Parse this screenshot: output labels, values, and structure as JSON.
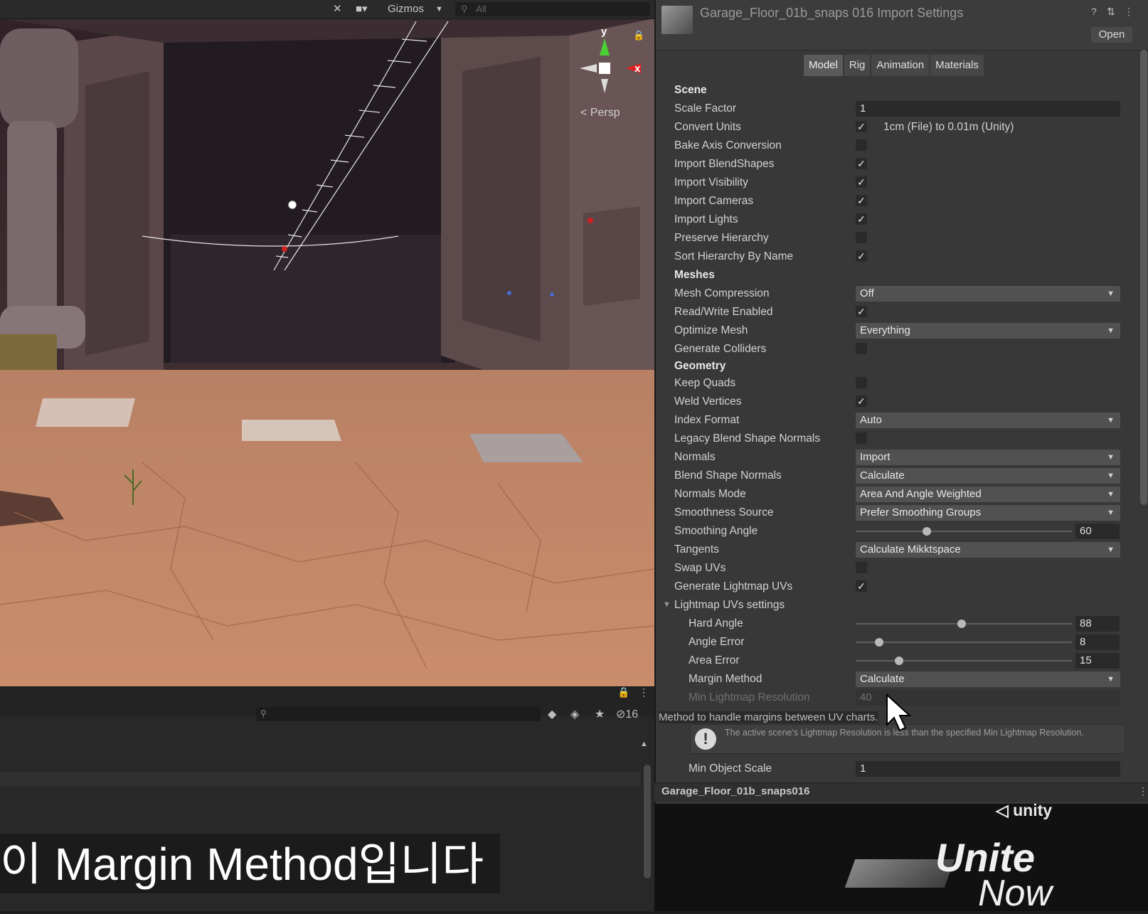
{
  "scene": {
    "gizmos_label": "Gizmos",
    "search_placeholder": "All",
    "persp_label": "Persp",
    "axis_y": "y",
    "axis_x": "x"
  },
  "hierarchy": {
    "hidden_count": "16"
  },
  "subtitle": "이 Margin Method입니다",
  "inspector": {
    "title": "Garage_Floor_01b_snaps 016 Import Settings",
    "open_label": "Open",
    "tabs": [
      "Model",
      "Rig",
      "Animation",
      "Materials"
    ],
    "sections": {
      "scene": "Scene",
      "meshes": "Meshes",
      "geometry": "Geometry"
    },
    "scale_factor": {
      "label": "Scale Factor",
      "value": "1"
    },
    "convert_units": {
      "label": "Convert Units",
      "checked": true,
      "text": "1cm (File) to 0.01m (Unity)"
    },
    "bake_axis": {
      "label": "Bake Axis Conversion",
      "checked": false
    },
    "import_blendshapes": {
      "label": "Import BlendShapes",
      "checked": true
    },
    "import_visibility": {
      "label": "Import Visibility",
      "checked": true
    },
    "import_cameras": {
      "label": "Import Cameras",
      "checked": true
    },
    "import_lights": {
      "label": "Import Lights",
      "checked": true
    },
    "preserve_hierarchy": {
      "label": "Preserve Hierarchy",
      "checked": false
    },
    "sort_hierarchy": {
      "label": "Sort Hierarchy By Name",
      "checked": true
    },
    "mesh_compression": {
      "label": "Mesh Compression",
      "value": "Off"
    },
    "read_write": {
      "label": "Read/Write Enabled",
      "checked": true
    },
    "optimize_mesh": {
      "label": "Optimize Mesh",
      "value": "Everything"
    },
    "generate_colliders": {
      "label": "Generate Colliders",
      "checked": false
    },
    "keep_quads": {
      "label": "Keep Quads",
      "checked": false
    },
    "weld_vertices": {
      "label": "Weld Vertices",
      "checked": true
    },
    "index_format": {
      "label": "Index Format",
      "value": "Auto"
    },
    "legacy_blend": {
      "label": "Legacy Blend Shape Normals",
      "checked": false
    },
    "normals": {
      "label": "Normals",
      "value": "Import"
    },
    "blend_shape_normals": {
      "label": "Blend Shape Normals",
      "value": "Calculate"
    },
    "normals_mode": {
      "label": "Normals Mode",
      "value": "Area And Angle Weighted"
    },
    "smoothness_source": {
      "label": "Smoothness Source",
      "value": "Prefer Smoothing Groups"
    },
    "smoothing_angle": {
      "label": "Smoothing Angle",
      "value": "60",
      "fraction": 0.33
    },
    "tangents": {
      "label": "Tangents",
      "value": "Calculate Mikktspace"
    },
    "swap_uvs": {
      "label": "Swap UVs",
      "checked": false
    },
    "generate_lightmap_uvs": {
      "label": "Generate Lightmap UVs",
      "checked": true
    },
    "lightmap_settings": {
      "label": "Lightmap UVs settings"
    },
    "hard_angle": {
      "label": "Hard Angle",
      "value": "88",
      "fraction": 0.49
    },
    "angle_error": {
      "label": "Angle Error",
      "value": "8",
      "fraction": 0.11
    },
    "area_error": {
      "label": "Area Error",
      "value": "15",
      "fraction": 0.2
    },
    "margin_method": {
      "label": "Margin Method",
      "value": "Calculate"
    },
    "min_lightmap_resolution": {
      "label": "Min Lightmap Resolution",
      "value": "40"
    },
    "tooltip": "Method to handle margins between UV charts.",
    "warning": "The active scene's Lightmap Resolution is less than the specified Min Lightmap Resolution.",
    "min_object_scale": {
      "label": "Min Object Scale",
      "value": "1"
    },
    "asset_name": "Garage_Floor_01b_snaps016"
  },
  "branding": {
    "unity": "unity",
    "unite": "Unite",
    "now": "Now"
  }
}
